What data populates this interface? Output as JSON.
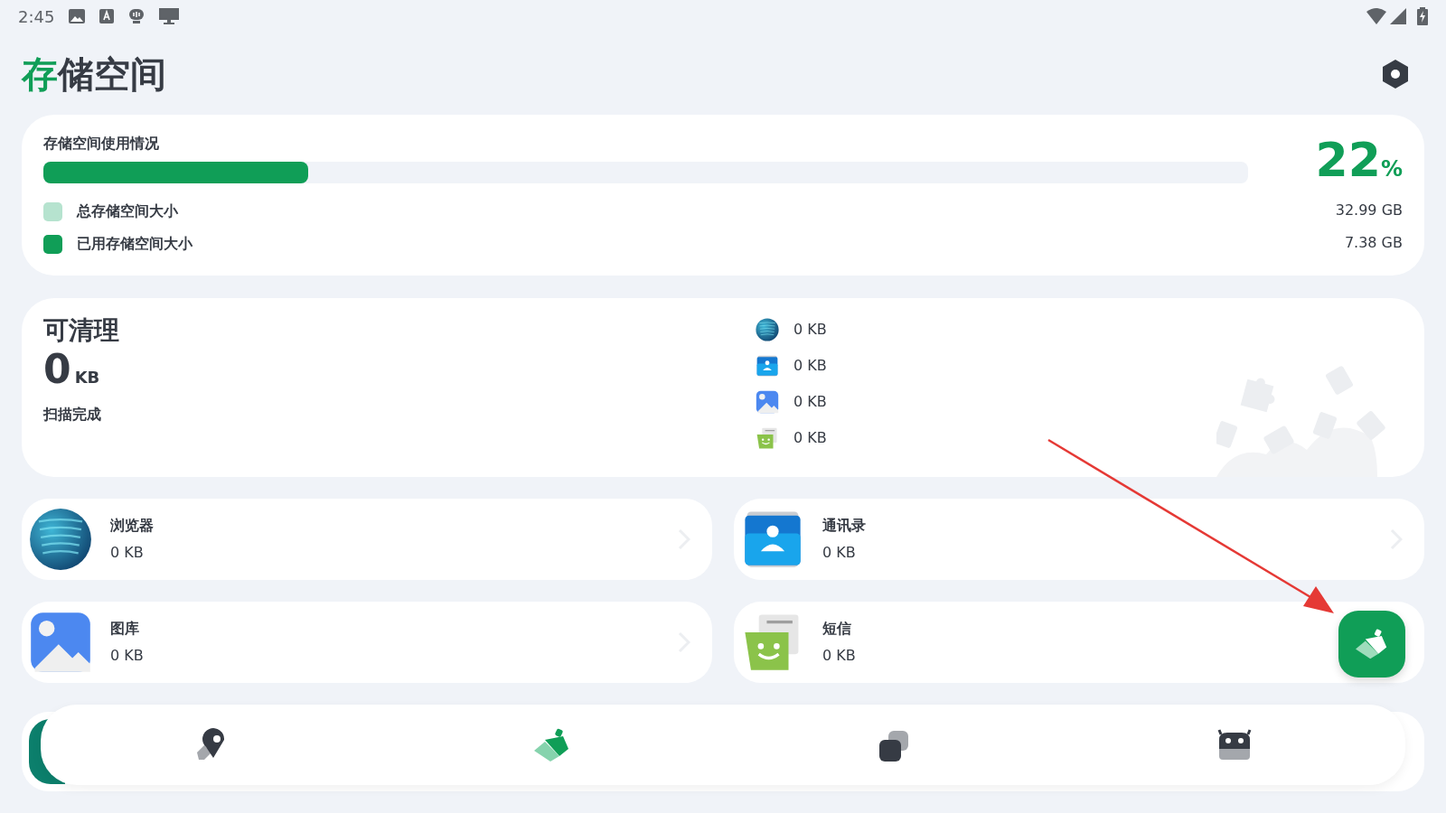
{
  "status_bar": {
    "time": "2:45"
  },
  "title": "存储空间",
  "usage": {
    "heading": "存储空间使用情况",
    "level": 0.22,
    "percent": "22",
    "percent_sign": "%",
    "legend": [
      {
        "label": "总存储空间大小",
        "color": "#b6e3cf",
        "value": "32.99 GB"
      },
      {
        "label": "已用存储空间大小",
        "color": "#109e57",
        "value": "7.38 GB"
      }
    ]
  },
  "cleanable": {
    "heading": "可清理",
    "amount": "0",
    "unit": "KB",
    "status": "扫描完成",
    "items": [
      {
        "kind": "browser",
        "size": "0 KB"
      },
      {
        "kind": "contacts",
        "size": "0 KB"
      },
      {
        "kind": "gallery",
        "size": "0 KB"
      },
      {
        "kind": "sms",
        "size": "0 KB"
      }
    ]
  },
  "apps": [
    {
      "kind": "browser",
      "name": "浏览器",
      "size": "0 KB",
      "chevron": true
    },
    {
      "kind": "contacts",
      "name": "通讯录",
      "size": "0 KB",
      "chevron": true
    },
    {
      "kind": "gallery",
      "name": "图库",
      "size": "0 KB",
      "chevron": true
    },
    {
      "kind": "sms",
      "name": "短信",
      "size": "0 KB",
      "chevron": false
    }
  ],
  "nav": [
    {
      "kind": "rocket",
      "selected": false
    },
    {
      "kind": "broom",
      "selected": true
    },
    {
      "kind": "apps",
      "selected": false
    },
    {
      "kind": "android",
      "selected": false
    }
  ]
}
